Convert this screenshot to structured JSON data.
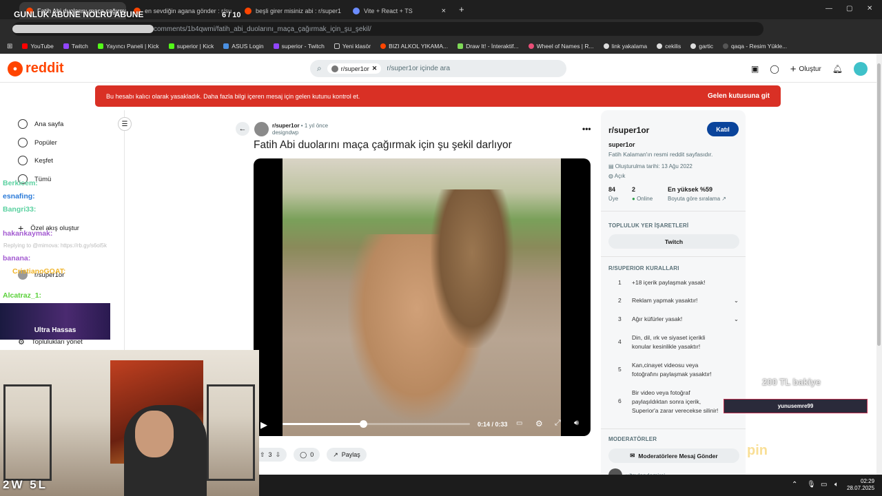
{
  "browser": {
    "tabs": [
      {
        "label": "Fatih Abi duolarını maça çağırmak",
        "active": true
      },
      {
        "label": "en sevdiğin agana gönder : r/su",
        "active": false
      },
      {
        "label": "beşli girer misiniz abi : r/super1",
        "active": false
      },
      {
        "label": "Vite + React + TS",
        "active": false
      }
    ],
    "new_tab": "+",
    "url": "comments/1b4qwmi/fatih_abi_duolarını_maça_çağırmak_için_şu_şekil/",
    "bookmarks": [
      "YouTube",
      "Twitch",
      "Yayıncı Paneli | Kick",
      "superior | Kick",
      "ASUS Login",
      "superior - Twitch",
      "Yeni klasör",
      "BIZI ALKOL YIKAMA...",
      "Draw It! - İnteraktif...",
      "Wheel of Names | R...",
      "link yakalama",
      "cekilis",
      "gartic",
      "qaqa - Resim Yükle..."
    ],
    "window_controls": [
      "—",
      "▢",
      "✕"
    ]
  },
  "header": {
    "logo_text": "reddit",
    "search_chip": "r/super1or",
    "search_placeholder": "r/super1or içinde ara",
    "create_label": "Oluştur"
  },
  "banner": {
    "message": "Bu hesabı kalıcı olarak yasakladık. Daha fazla bilgi içeren mesaj için gelen kutunu kontrol et.",
    "action": "Gelen kutusuna git"
  },
  "left_nav": {
    "items": [
      "Ana sayfa",
      "Popüler",
      "Keşfet",
      "Tümü"
    ],
    "custom_feed": "Özel akış oluştur",
    "community": "r/super1or",
    "manage": "Toplulukları yönet"
  },
  "chat_overlay": {
    "lines": [
      "Berkicem:",
      "esnafing:",
      "Bangri33:",
      "hakankaymak:",
      "banana:",
      "CristianoGOAT:",
      "Alcatraz_1:"
    ],
    "reply": "Replying to @mimova: https://rb.gy/s6ol5k",
    "ultra_label": "Ultra Hassas"
  },
  "post": {
    "subreddit": "r/super1or",
    "time": "1 yıl önce",
    "author": "designdwp",
    "title": "Fatih Abi duolarını maça çağırmak için şu şekil darlıyor",
    "video_time": "0:14 / 0:33",
    "progress": 0.43,
    "votes": "3",
    "comments": "0",
    "share": "Paylaş"
  },
  "sidebar": {
    "name": "r/super1or",
    "join": "Katıl",
    "handle": "super1or",
    "description": "Fatih Kalaman'ın resmi reddit sayfasıdır.",
    "created": "Oluşturulma tarihi: 13 Ağu 2022",
    "visibility": "Açık",
    "members": "84",
    "members_label": "Üye",
    "online": "2",
    "online_label": "Online",
    "rank": "En yüksek %59",
    "rank_label": "Boyuta göre sıralama",
    "bookmarks_title": "TOPLULUK YER İŞARETLERİ",
    "bookmark_button": "Twitch",
    "rules_title": "R/SUPERIOR KURALLARI",
    "rules": [
      "+18 içerik paylaşmak yasak!",
      "Reklam yapmak yasaktır!",
      "Ağır küfürler yasak!",
      "Din, dil, ırk ve siyaset içerikli konular kesinlikle yasaktır!",
      "Kan,cinayet videosu veya fotoğrafını paylaşmak yasaktır!",
      "Bir video veya fotoğraf paylaşıldıktan sonra içerik, Superior'a zarar verecekse silinir!"
    ],
    "mods_title": "MODERATÖRLER",
    "mod_button": "Moderatörlere Mesaj Gönder",
    "mod_user": "u/taylandemirci"
  },
  "stream_overlay": {
    "top_text": "GUNLUK ABUNE NOLRU ABUNE",
    "counter": "6  / 10",
    "score": "2W 5L",
    "balance": "200 TL bakiye",
    "donor": "yunusemre99",
    "sponsor": "pin"
  },
  "taskbar": {
    "time": "02:29",
    "date": "28.07.2025"
  },
  "colors": {
    "reddit_orange": "#ff4500",
    "ban_red": "#d93025",
    "join_blue": "#0a449b"
  }
}
